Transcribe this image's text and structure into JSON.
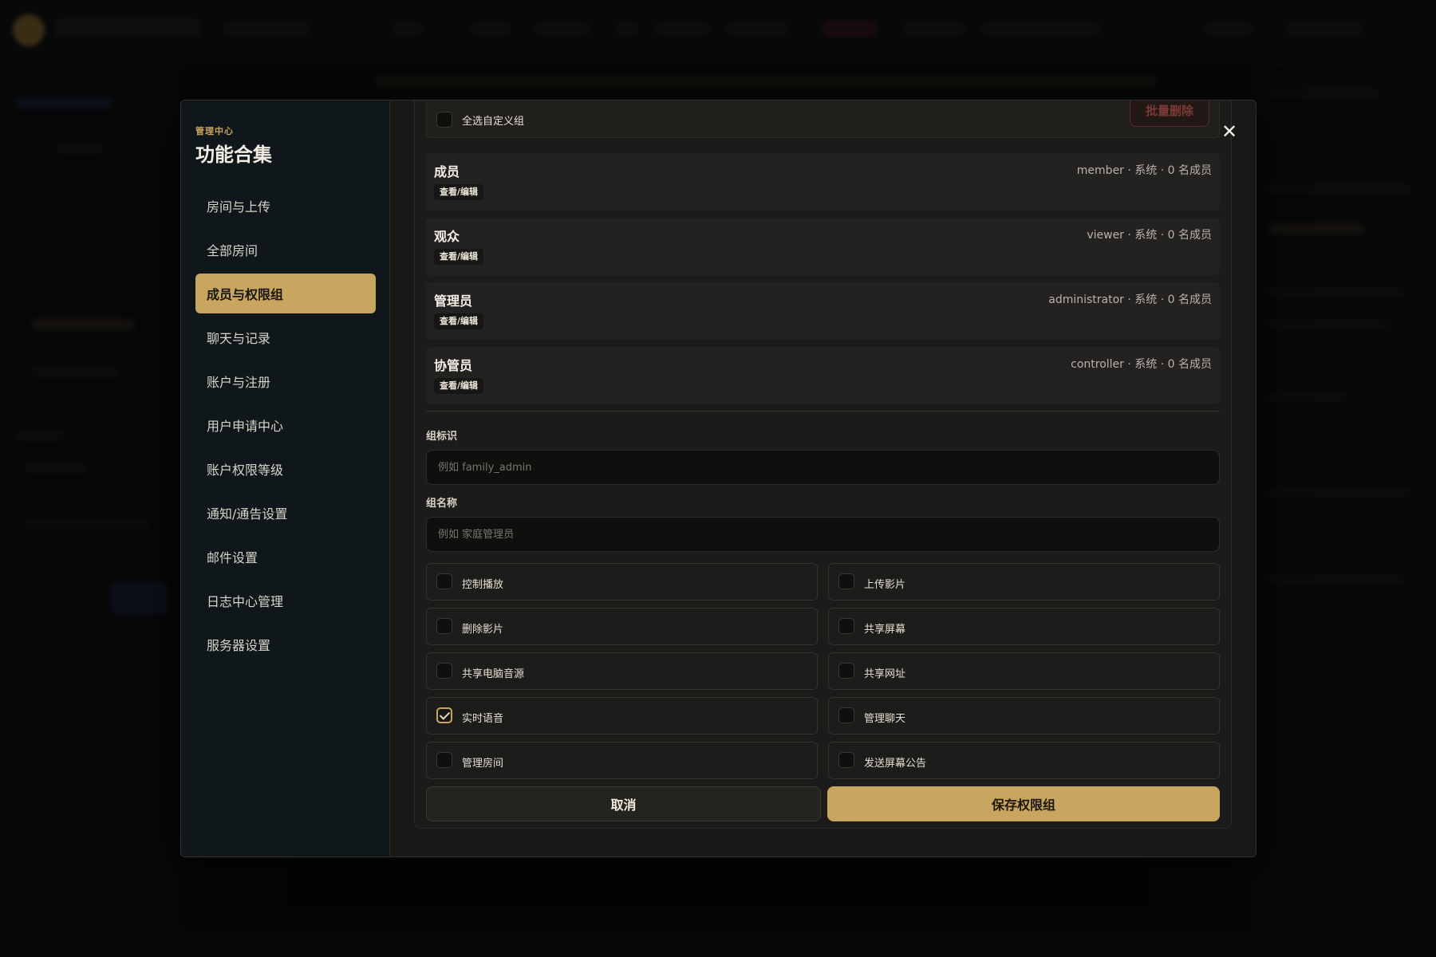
{
  "sidebar": {
    "kicker": "管理中心",
    "title": "功能合集",
    "items": [
      {
        "label": "房间与上传"
      },
      {
        "label": "全部房间"
      },
      {
        "label": "成员与权限组",
        "active": true
      },
      {
        "label": "聊天与记录"
      },
      {
        "label": "账户与注册"
      },
      {
        "label": "用户申请中心"
      },
      {
        "label": "账户权限等级"
      },
      {
        "label": "通知/通告设置"
      },
      {
        "label": "邮件设置"
      },
      {
        "label": "日志中心管理"
      },
      {
        "label": "服务器设置"
      }
    ]
  },
  "close_icon": "close-icon",
  "select_all_label": "全选自定义组",
  "bulk_delete_label": "批量删除",
  "groups": [
    {
      "name": "成员",
      "edit_label": "查看/编辑",
      "meta": "member · 系统 · 0 名成员"
    },
    {
      "name": "观众",
      "edit_label": "查看/编辑",
      "meta": "viewer · 系统 · 0 名成员"
    },
    {
      "name": "管理员",
      "edit_label": "查看/编辑",
      "meta": "administrator · 系统 · 0 名成员"
    },
    {
      "name": "协管员",
      "edit_label": "查看/编辑",
      "meta": "controller · 系统 · 0 名成员"
    }
  ],
  "form": {
    "id_label": "组标识",
    "id_placeholder": "例如 family_admin",
    "id_value": "",
    "name_label": "组名称",
    "name_placeholder": "例如 家庭管理员",
    "name_value": ""
  },
  "permissions": [
    {
      "label": "控制播放",
      "checked": false
    },
    {
      "label": "上传影片",
      "checked": false
    },
    {
      "label": "删除影片",
      "checked": false
    },
    {
      "label": "共享屏幕",
      "checked": false
    },
    {
      "label": "共享电脑音源",
      "checked": false
    },
    {
      "label": "共享网址",
      "checked": false
    },
    {
      "label": "实时语音",
      "checked": true
    },
    {
      "label": "管理聊天",
      "checked": false
    },
    {
      "label": "管理房间",
      "checked": false
    },
    {
      "label": "发送屏幕公告",
      "checked": false
    }
  ],
  "actions": {
    "cancel_label": "取消",
    "save_label": "保存权限组"
  },
  "colors": {
    "accent": "#c9a660",
    "sidebar_bg": "#10171b",
    "danger": "#7c3b36"
  }
}
